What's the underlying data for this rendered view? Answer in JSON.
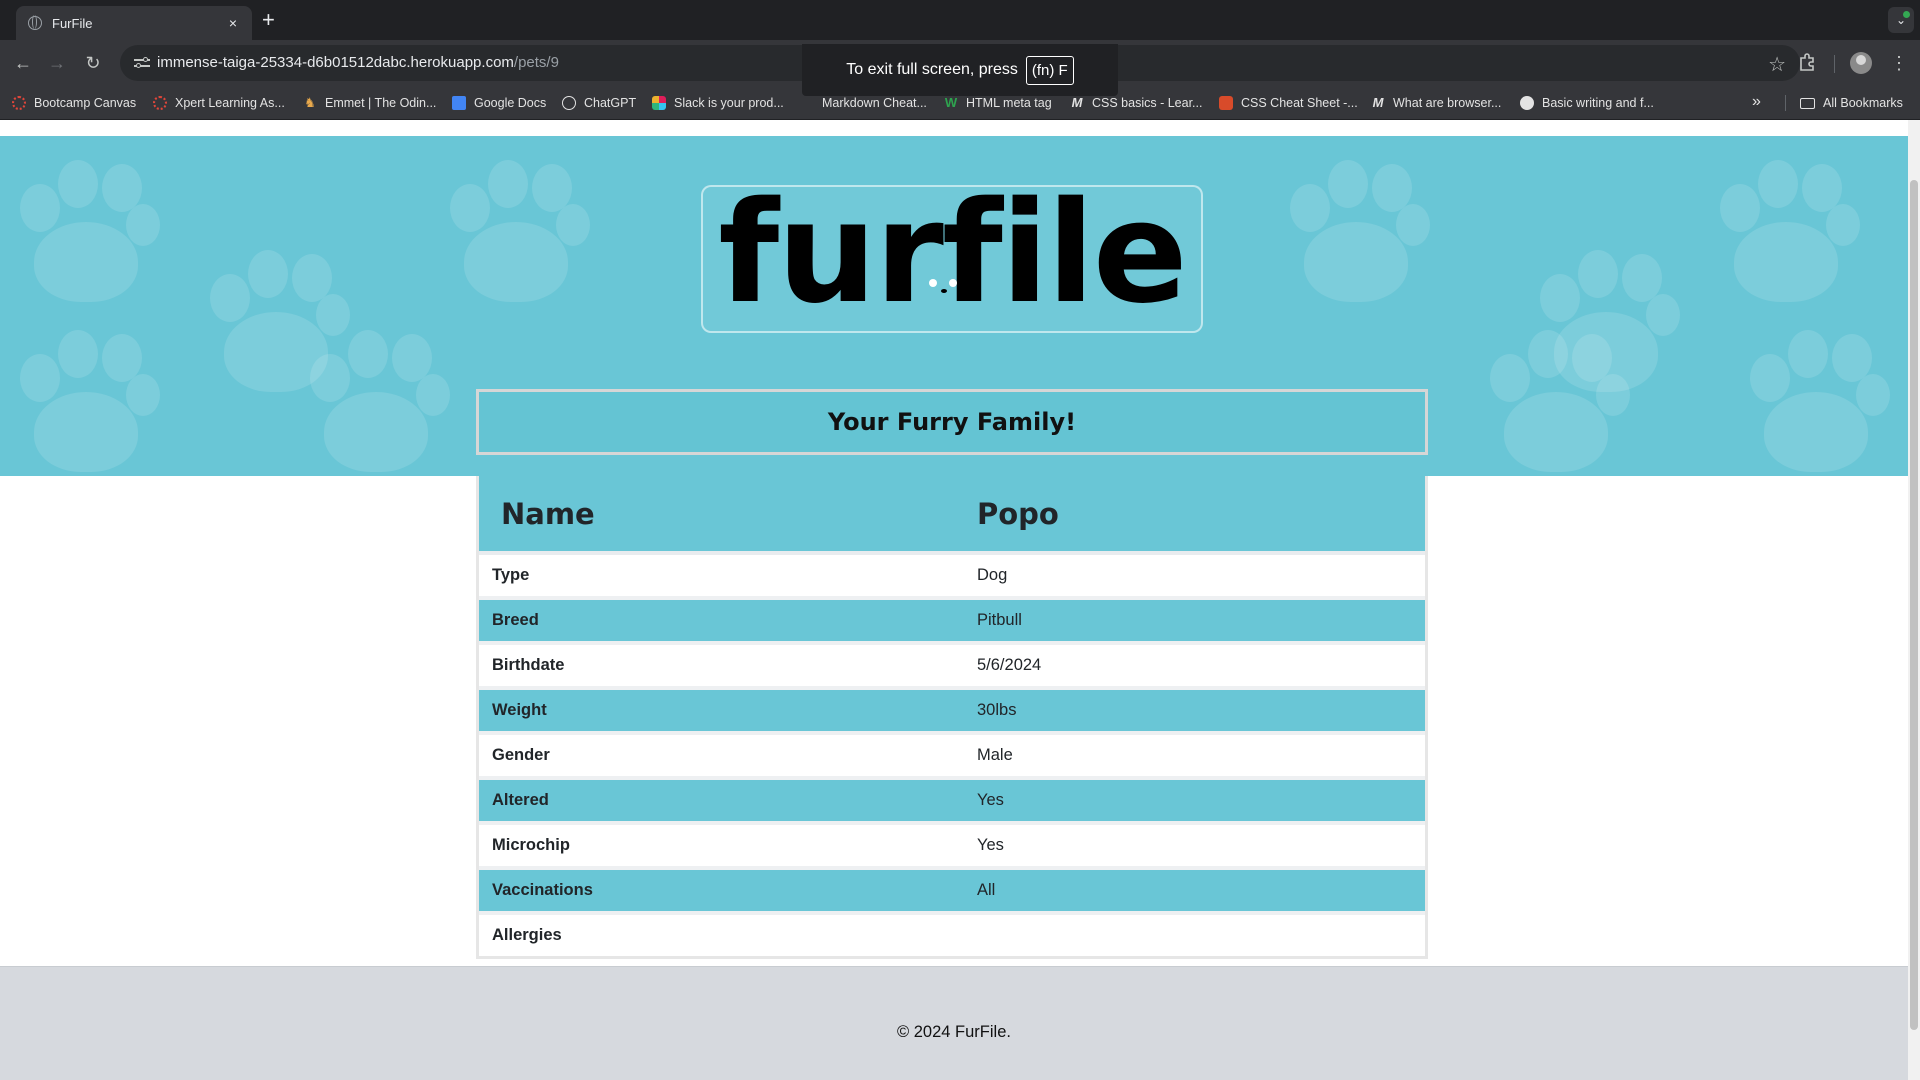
{
  "browser": {
    "tab_title": "FurFile",
    "tab_close": "×",
    "new_tab": "+",
    "tab_menu": "⌄",
    "url_host": "immense-taiga-25334-d6b01512dabc.herokuapp.com",
    "url_path": "/pets/9",
    "back": "←",
    "forward": "→",
    "reload": "↻",
    "star": "☆",
    "kebab": "⋮",
    "fullscreen_toast": "To exit full screen, press",
    "fullscreen_key": "(fn) F",
    "bookmarks": [
      {
        "label": "Bootcamp Canvas",
        "icon": "canvas-icon"
      },
      {
        "label": "Xpert Learning As...",
        "icon": "canvas-icon"
      },
      {
        "label": "Emmet | The Odin...",
        "icon": "horse-icon"
      },
      {
        "label": "Google Docs",
        "icon": "docs-icon"
      },
      {
        "label": "ChatGPT",
        "icon": "chatgpt-icon"
      },
      {
        "label": "Slack is your prod...",
        "icon": "slack-icon"
      },
      {
        "label": "Markdown Cheat...",
        "icon": "markdown-icon"
      },
      {
        "label": "HTML meta tag",
        "icon": "w-icon"
      },
      {
        "label": "CSS basics - Lear...",
        "icon": "m-icon"
      },
      {
        "label": "CSS Cheat Sheet -...",
        "icon": "css-icon"
      },
      {
        "label": "What are browser...",
        "icon": "m-icon"
      },
      {
        "label": "Basic writing and f...",
        "icon": "github-icon"
      }
    ],
    "bookmarks_more": "»",
    "all_bookmarks": "All Bookmarks"
  },
  "page": {
    "logo": "furfile",
    "banner": "Your Furry Family!",
    "header": {
      "key": "Name",
      "value": "Popo"
    },
    "rows": [
      {
        "key": "Type",
        "value": "Dog"
      },
      {
        "key": "Breed",
        "value": "Pitbull"
      },
      {
        "key": "Birthdate",
        "value": "5/6/2024"
      },
      {
        "key": "Weight",
        "value": "30lbs"
      },
      {
        "key": "Gender",
        "value": "Male"
      },
      {
        "key": "Altered",
        "value": "Yes"
      },
      {
        "key": "Microchip",
        "value": "Yes"
      },
      {
        "key": "Vaccinations",
        "value": "All"
      },
      {
        "key": "Allergies",
        "value": ""
      }
    ],
    "footer": "© 2024 FurFile."
  },
  "colors": {
    "accent": "#69c6d6",
    "chrome_dark": "#202124",
    "chrome": "#35363a",
    "footer_bg": "#d6d9de"
  }
}
